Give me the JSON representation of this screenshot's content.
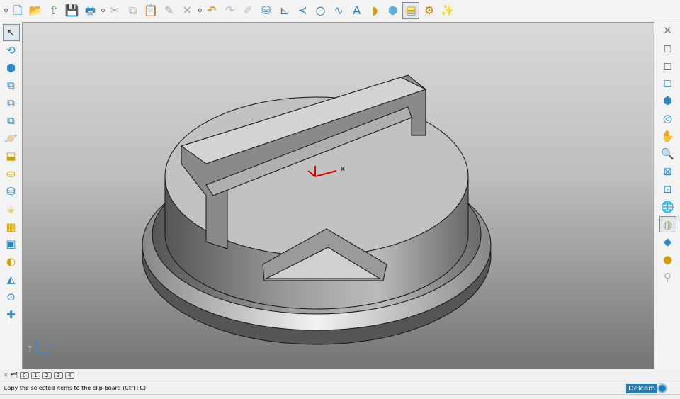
{
  "top_toolbar": [
    {
      "icon": "sep"
    },
    {
      "icon": "new-file-icon",
      "g": "🗋",
      "c": "#1a8fd0"
    },
    {
      "icon": "open-folder-icon",
      "g": "📂",
      "c": "#e0a020"
    },
    {
      "icon": "import-icon",
      "g": "⇧",
      "c": "#2a9a40"
    },
    {
      "icon": "save-icon",
      "g": "💾",
      "c": "#222"
    },
    {
      "icon": "print-icon",
      "g": "🖶",
      "c": "#2a8ac8"
    },
    {
      "icon": "sep"
    },
    {
      "icon": "cut-icon",
      "g": "✂",
      "c": "#aaa"
    },
    {
      "icon": "copy-icon",
      "g": "⧉",
      "c": "#aaa"
    },
    {
      "icon": "paste-icon",
      "g": "📋",
      "c": "#aaa"
    },
    {
      "icon": "edit-icon",
      "g": "✎",
      "c": "#aaa"
    },
    {
      "icon": "delete-icon",
      "g": "✕",
      "c": "#aaa"
    },
    {
      "icon": "sep"
    },
    {
      "icon": "undo-icon",
      "g": "↶",
      "c": "#d09000"
    },
    {
      "icon": "redo-icon",
      "g": "↷",
      "c": "#bbb"
    },
    {
      "icon": "sketch-icon",
      "g": "✐",
      "c": "#bbb"
    },
    {
      "icon": "surface-icon",
      "g": "⛁",
      "c": "#2a8ac8"
    },
    {
      "icon": "workplane-icon",
      "g": "⊾",
      "c": "#2a7ab8"
    },
    {
      "icon": "line-icon",
      "g": "≺",
      "c": "#2a7ab8"
    },
    {
      "icon": "circle-icon",
      "g": "○",
      "c": "#2a7ab8"
    },
    {
      "icon": "curve-icon",
      "g": "∿",
      "c": "#2a7ab8"
    },
    {
      "icon": "text-icon",
      "g": "A",
      "c": "#2a7ab8"
    },
    {
      "icon": "surface-patch-icon",
      "g": "◗",
      "c": "#d0a000"
    },
    {
      "icon": "solid-icon",
      "g": "⬢",
      "c": "#5ab0d8"
    },
    {
      "icon": "feature-icon",
      "g": "▤",
      "c": "#d0a000",
      "active": true
    },
    {
      "icon": "gears-icon",
      "g": "⚙",
      "c": "#c08000"
    },
    {
      "icon": "wizard-icon",
      "g": "✨",
      "c": "#2a8ac8"
    }
  ],
  "left_toolbar": [
    {
      "icon": "select-cursor-icon",
      "g": "↖",
      "c": "#333",
      "active": true
    },
    {
      "icon": "rotate-view-icon",
      "g": "⟲",
      "c": "#2a8ac8"
    },
    {
      "icon": "cube-select-icon",
      "g": "⬢",
      "c": "#2a8ac8"
    },
    {
      "icon": "boolean-add-icon",
      "g": "⧉",
      "c": "#2a7ab8"
    },
    {
      "icon": "boolean-subtract-icon",
      "g": "⧉",
      "c": "#2a7ab8"
    },
    {
      "icon": "boolean-intersect-icon",
      "g": "⧉",
      "c": "#2a7ab8"
    },
    {
      "icon": "orbit-icon",
      "g": "🪐",
      "c": "#d0a000"
    },
    {
      "icon": "extrude-icon",
      "g": "⬓",
      "c": "#d0a000"
    },
    {
      "icon": "cylinder-icon",
      "g": "⛀",
      "c": "#d0a000"
    },
    {
      "icon": "revolve-icon",
      "g": "⛁",
      "c": "#2a8ac8"
    },
    {
      "icon": "draft-icon",
      "g": "⏚",
      "c": "#d0a000"
    },
    {
      "icon": "shell-icon",
      "g": "▦",
      "c": "#d0a000"
    },
    {
      "icon": "box-icon",
      "g": "▣",
      "c": "#2a8ac8"
    },
    {
      "icon": "fillet-icon",
      "g": "◐",
      "c": "#d0a000"
    },
    {
      "icon": "sweep-icon",
      "g": "◭",
      "c": "#2a8ac8"
    },
    {
      "icon": "pin-icon",
      "g": "⊙",
      "c": "#2a8ac8"
    },
    {
      "icon": "measure-icon",
      "g": "✚",
      "c": "#2a8ac8"
    }
  ],
  "right_toolbar": [
    {
      "icon": "close-icon",
      "g": "✕",
      "c": "#777"
    },
    {
      "icon": "view-front-icon",
      "g": "◻",
      "c": "#555"
    },
    {
      "icon": "view-side-icon",
      "g": "◻",
      "c": "#555"
    },
    {
      "icon": "view-top-icon",
      "g": "◻",
      "c": "#2a8ac8"
    },
    {
      "icon": "view-iso-icon",
      "g": "⬢",
      "c": "#2a8ac8"
    },
    {
      "icon": "camera-icon",
      "g": "◎",
      "c": "#2a8ac8"
    },
    {
      "icon": "pan-icon",
      "g": "✋",
      "c": "#c08000"
    },
    {
      "icon": "zoom-icon",
      "g": "🔍",
      "c": "#2a8ac8"
    },
    {
      "icon": "zoom-fit-icon",
      "g": "⊠",
      "c": "#2a8ac8"
    },
    {
      "icon": "zoom-box-icon",
      "g": "⊡",
      "c": "#2a8ac8"
    },
    {
      "icon": "wireframe-icon",
      "g": "🌐",
      "c": "#555"
    },
    {
      "icon": "shaded-icon",
      "g": "◍",
      "c": "#d0a000",
      "active": true
    },
    {
      "icon": "analysis-icon",
      "g": "◆",
      "c": "#2a8ac8"
    },
    {
      "icon": "lighting-icon",
      "g": "●",
      "c": "#d0a000"
    },
    {
      "icon": "material-icon",
      "g": "⚲",
      "c": "#aaa"
    }
  ],
  "viewport": {
    "axis_label": "x",
    "triad_y": "Y",
    "triad_x": "X"
  },
  "bottom_bar": {
    "levels": [
      "0",
      "1",
      "2",
      "3",
      "4"
    ]
  },
  "status": {
    "message": "Copy the selected items to the clip-board (Ctrl+C)",
    "brand": "Delcam"
  }
}
